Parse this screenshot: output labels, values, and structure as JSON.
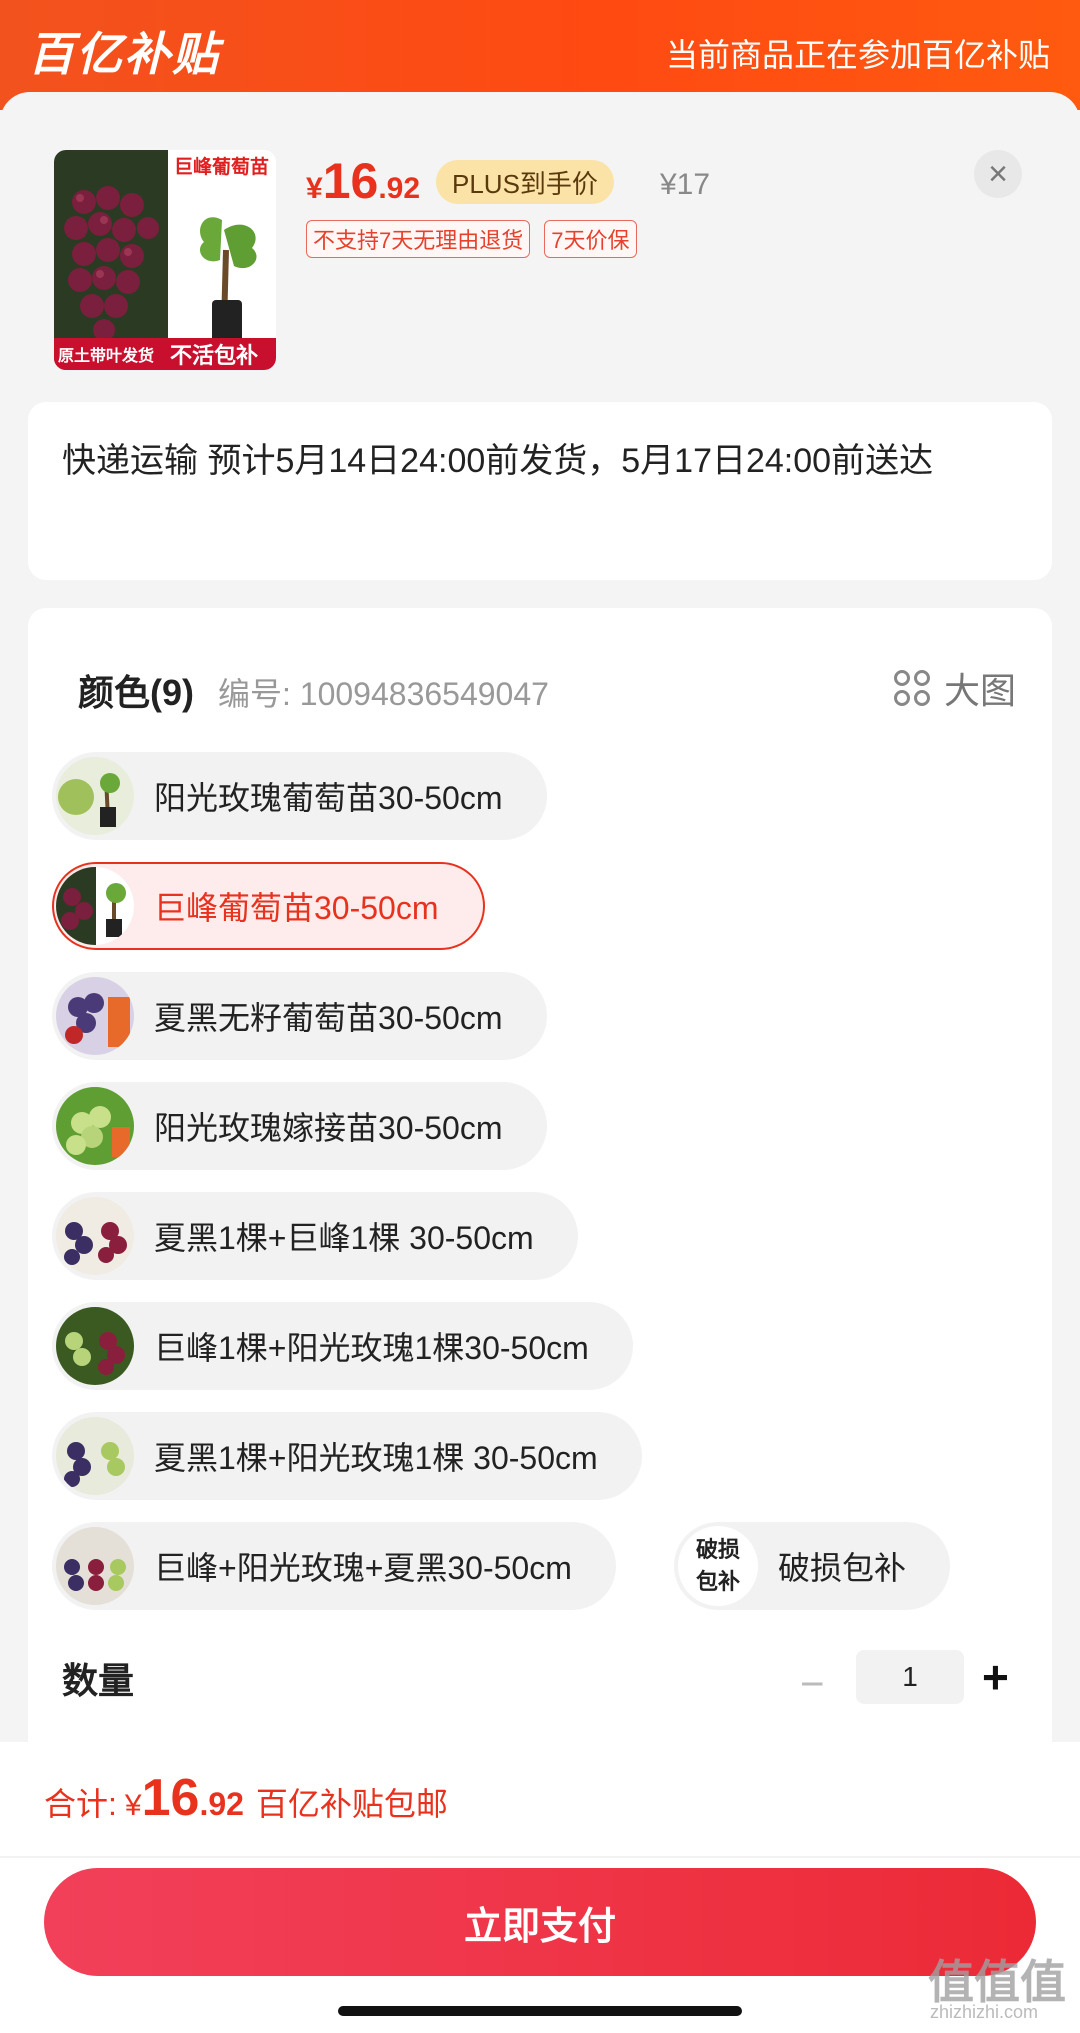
{
  "banner": {
    "logo": "百亿补贴",
    "slogan": "当前商品正在参加百亿补贴"
  },
  "product": {
    "thumb_title": "巨峰葡萄苗",
    "thumb_tag_left": "原土带叶发货",
    "thumb_tag_right": "不活包补",
    "price_currency": "¥",
    "price_int": "16",
    "price_dec": ".92",
    "plus_label": "PLUS到手价",
    "original_price": "¥17",
    "tags": [
      "不支持7天无理由退货",
      "7天价保"
    ],
    "close_icon": "×"
  },
  "shipping": {
    "text": "快递运输 预计5月14日24:00前发货，5月17日24:00前送达"
  },
  "spec": {
    "title": "颜色(9)",
    "code": "编号: 10094836549047",
    "big_view": "大图",
    "options": [
      {
        "label": "阳光玫瑰葡萄苗30-50cm",
        "selected": false
      },
      {
        "label": "巨峰葡萄苗30-50cm",
        "selected": true
      },
      {
        "label": "夏黑无籽葡萄苗30-50cm",
        "selected": false
      },
      {
        "label": "阳光玫瑰嫁接苗30-50cm",
        "selected": false
      },
      {
        "label": "夏黑1棵+巨峰1棵 30-50cm",
        "selected": false
      },
      {
        "label": "巨峰1棵+阳光玫瑰1棵30-50cm",
        "selected": false
      },
      {
        "label": "夏黑1棵+阳光玫瑰1棵 30-50cm",
        "selected": false
      },
      {
        "label": "巨峰+阳光玫瑰+夏黑30-50cm",
        "selected": false
      }
    ],
    "extra_option": {
      "icon_line1": "破损",
      "icon_line2": "包补",
      "label": "破损包补"
    }
  },
  "quantity": {
    "label": "数量",
    "minus": "−",
    "value": "1",
    "plus": "+"
  },
  "footer": {
    "total_label": "合计:",
    "currency": "¥",
    "total_int": "16",
    "total_dec": ".92",
    "note": "百亿补贴包邮",
    "pay_button": "立即支付"
  },
  "watermark": {
    "main": "值值值",
    "sub": "zhizhizhi.com"
  }
}
